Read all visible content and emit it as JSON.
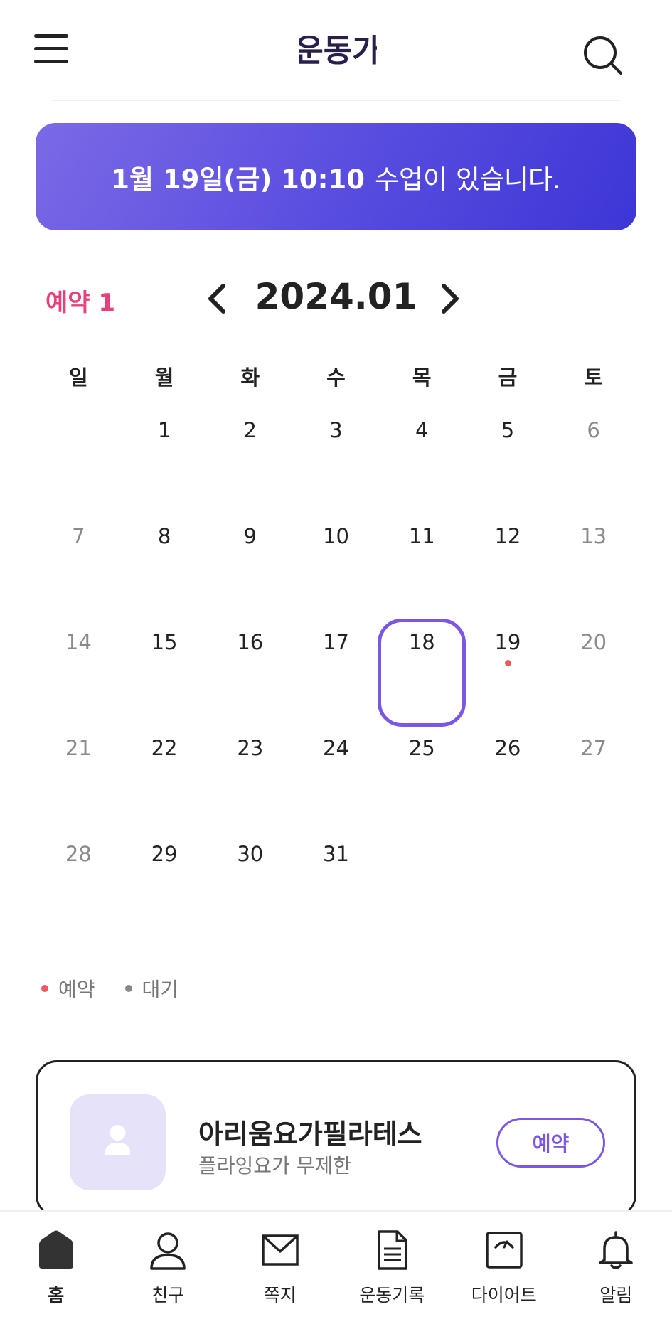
{
  "header": {
    "menu_icon": "hamburger-menu-icon",
    "logo_text": "운동가",
    "search_icon": "search-icon"
  },
  "banner": {
    "date_time": "1월 19일(금) 10:10",
    "message": "수업이 있습니다."
  },
  "calendar": {
    "reserve_label": "예약 1",
    "month": "2024.01",
    "prev_icon": "chevron-left-icon",
    "next_icon": "chevron-right-icon",
    "weekdays": [
      "일",
      "월",
      "화",
      "수",
      "목",
      "금",
      "토"
    ],
    "days": [
      "",
      "1",
      "2",
      "3",
      "4",
      "5",
      "6",
      "7",
      "8",
      "9",
      "10",
      "11",
      "12",
      "13",
      "14",
      "15",
      "16",
      "17",
      "18",
      "19",
      "20",
      "21",
      "22",
      "23",
      "24",
      "25",
      "26",
      "27",
      "28",
      "29",
      "30",
      "31"
    ],
    "today": "18",
    "reserved_days": [
      "19"
    ],
    "accent_color": "#7a58e4",
    "reserve_dot_color": "#ea5b62"
  },
  "legend": {
    "reserved": "예약",
    "waiting": "대기",
    "reserved_color": "#ea5b62",
    "waiting_color": "#888888"
  },
  "card": {
    "title": "아리움요가필라테스",
    "subtitle": "플라잉요가 무제한",
    "button": "예약",
    "thumb_icon": "person-icon"
  },
  "nav": [
    {
      "label": "홈",
      "icon": "home-icon",
      "active": true
    },
    {
      "label": "친구",
      "icon": "friend-icon"
    },
    {
      "label": "쪽지",
      "icon": "mail-icon"
    },
    {
      "label": "운동기록",
      "icon": "document-icon"
    },
    {
      "label": "다이어트",
      "icon": "scale-icon"
    },
    {
      "label": "알림",
      "icon": "bell-icon"
    }
  ]
}
